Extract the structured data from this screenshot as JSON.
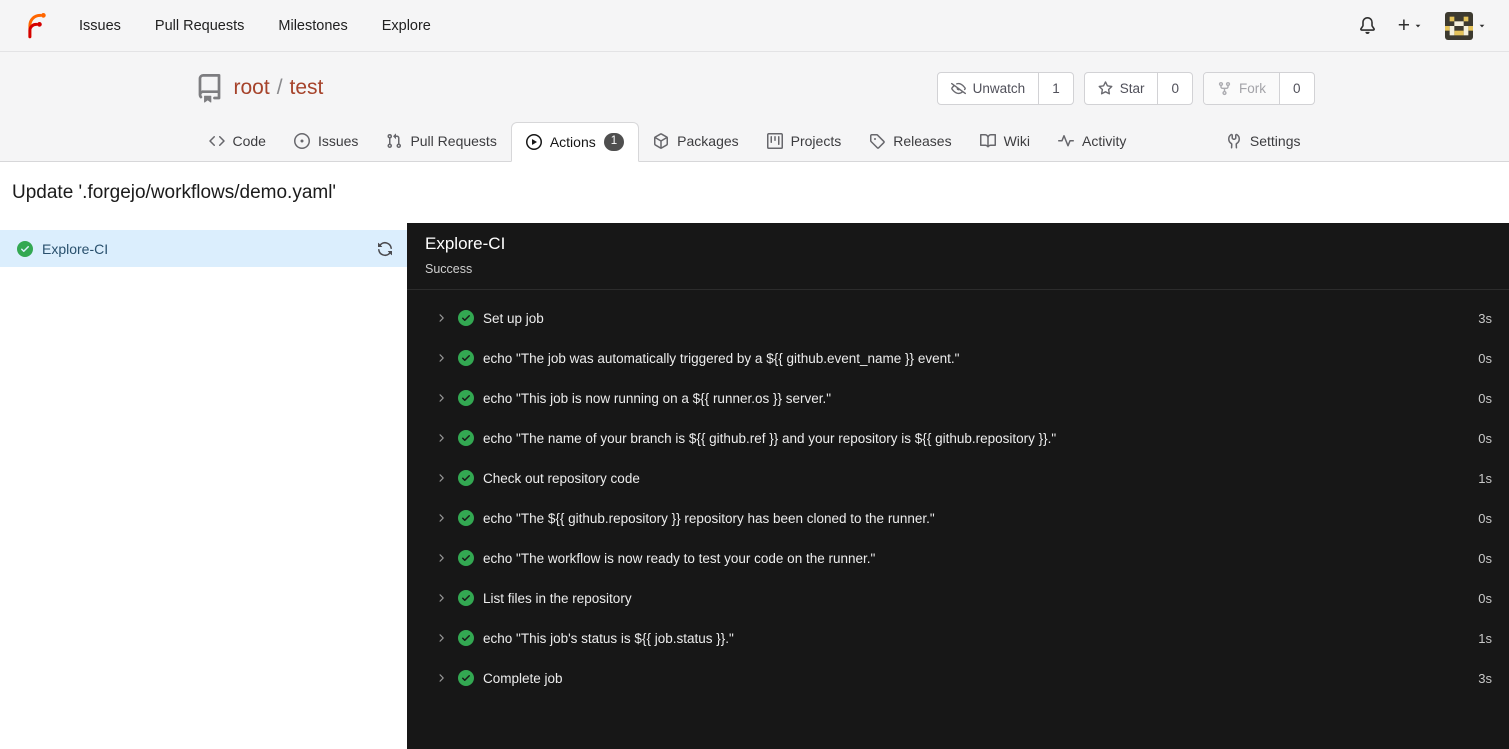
{
  "navbar": {
    "links": [
      "Issues",
      "Pull Requests",
      "Milestones",
      "Explore"
    ],
    "right_icons": [
      "bell-icon",
      "plus-icon",
      "caret-down-icon",
      "avatar",
      "caret-down-icon"
    ]
  },
  "repo": {
    "icon": "repo-icon",
    "owner": "root",
    "separator": "/",
    "name": "test",
    "buttons": [
      {
        "label": "Unwatch",
        "count": "1",
        "icon": "eye-closed-icon"
      },
      {
        "label": "Star",
        "count": "0",
        "icon": "star-icon"
      },
      {
        "label": "Fork",
        "count": "0",
        "icon": "fork-icon",
        "disabled": true
      }
    ],
    "tabs": [
      {
        "label": "Code",
        "icon": "code-icon"
      },
      {
        "label": "Issues",
        "icon": "issue-opened-icon"
      },
      {
        "label": "Pull Requests",
        "icon": "git-pull-request-icon"
      },
      {
        "label": "Actions",
        "icon": "play-icon",
        "badge": "1",
        "active": true
      },
      {
        "label": "Packages",
        "icon": "package-icon"
      },
      {
        "label": "Projects",
        "icon": "project-icon"
      },
      {
        "label": "Releases",
        "icon": "tag-icon"
      },
      {
        "label": "Wiki",
        "icon": "book-icon"
      },
      {
        "label": "Activity",
        "icon": "pulse-icon"
      },
      {
        "label": "Settings",
        "icon": "tools-icon"
      }
    ]
  },
  "run": {
    "commit_title": "Update '.forgejo/workflows/demo.yaml'",
    "jobs": [
      {
        "name": "Explore-CI",
        "status": "success",
        "selected": true,
        "icon": "check-circle-icon",
        "action_icon": "sync-icon"
      }
    ],
    "panel": {
      "title": "Explore-CI",
      "status_text": "Success"
    },
    "steps": [
      {
        "name": "Set up job",
        "duration": "3s",
        "status": "success"
      },
      {
        "name": "echo \"The job was automatically triggered by a ${{ github.event_name }} event.\"",
        "duration": "0s",
        "status": "success"
      },
      {
        "name": "echo \"This job is now running on a ${{ runner.os }} server.\"",
        "duration": "0s",
        "status": "success"
      },
      {
        "name": "echo \"The name of your branch is ${{ github.ref }} and your repository is ${{ github.repository }}.\"",
        "duration": "0s",
        "status": "success"
      },
      {
        "name": "Check out repository code",
        "duration": "1s",
        "status": "success"
      },
      {
        "name": "echo \"The ${{ github.repository }} repository has been cloned to the runner.\"",
        "duration": "0s",
        "status": "success"
      },
      {
        "name": "echo \"The workflow is now ready to test your code on the runner.\"",
        "duration": "0s",
        "status": "success"
      },
      {
        "name": "List files in the repository",
        "duration": "0s",
        "status": "success"
      },
      {
        "name": "echo \"This job's status is ${{ job.status }}.\"",
        "duration": "1s",
        "status": "success"
      },
      {
        "name": "Complete job",
        "duration": "3s",
        "status": "success"
      }
    ]
  },
  "colors": {
    "primary": "#a6432b",
    "success_green": "#33a852",
    "panel_bg": "#171717",
    "selected_job_bg": "#dbeefd",
    "chrome_bg": "#f5f5f6",
    "badge_bg": "#4f4f4f"
  }
}
